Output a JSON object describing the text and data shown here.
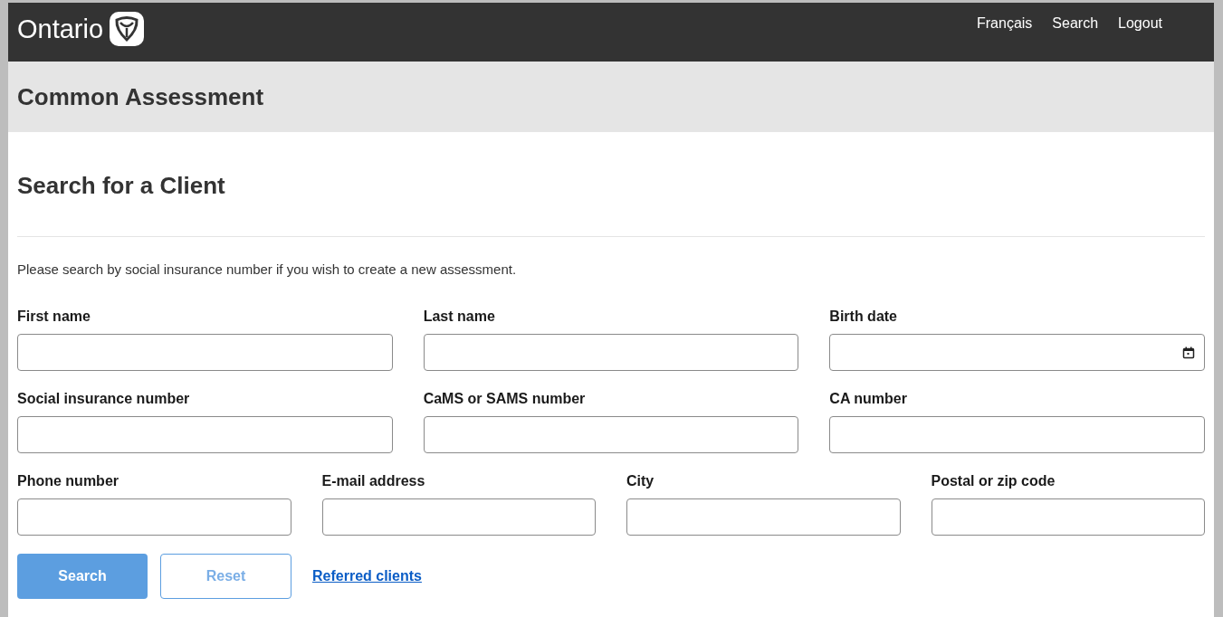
{
  "header": {
    "logo": "Ontario",
    "links": [
      "Français",
      "Search",
      "Logout"
    ]
  },
  "banner": {
    "title": "Common Assessment"
  },
  "page": {
    "title": "Search for a Client",
    "instructions": "Please search by social insurance number if you wish to create a new assessment."
  },
  "form_rows": [
    {
      "fields": [
        {
          "label": "First name",
          "kind": "text"
        },
        {
          "label": "Last name",
          "kind": "text"
        },
        {
          "label": "Birth date",
          "kind": "date"
        }
      ]
    },
    {
      "fields": [
        {
          "label": "Social insurance number",
          "kind": "text"
        },
        {
          "label": "CaMS or SAMS number",
          "kind": "text"
        },
        {
          "label": "CA number",
          "kind": "text"
        }
      ]
    },
    {
      "fields": [
        {
          "label": "Phone number",
          "kind": "text"
        },
        {
          "label": "E-mail address",
          "kind": "text"
        },
        {
          "label": "City",
          "kind": "text"
        },
        {
          "label": "Postal or zip code",
          "kind": "text"
        }
      ]
    }
  ],
  "actions": [
    {
      "kind": "primary",
      "label": "Search",
      "disabled": true
    },
    {
      "kind": "secondary",
      "label": "Reset",
      "disabled": true
    },
    {
      "kind": "link",
      "label": "Referred clients",
      "disabled": false
    }
  ]
}
